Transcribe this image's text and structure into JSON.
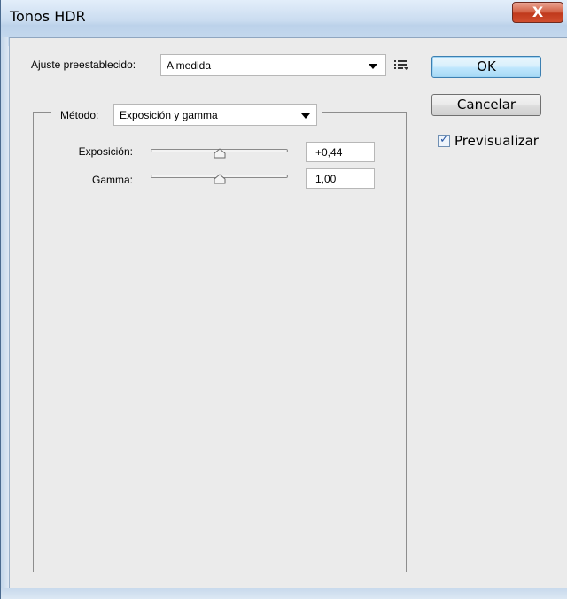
{
  "window": {
    "title": "Tonos HDR",
    "close_glyph": "X"
  },
  "preset": {
    "label": "Ajuste preestablecido:",
    "selected": "A medida",
    "menu_icon": "list-options-icon"
  },
  "buttons": {
    "ok": "OK",
    "cancel": "Cancelar"
  },
  "preview": {
    "label": "Previsualizar",
    "checked": true,
    "check_glyph": "✓"
  },
  "method": {
    "label": "Método:",
    "selected": "Exposición y gamma"
  },
  "sliders": [
    {
      "label": "Exposición:",
      "value": "+0,44",
      "level": 0.5
    },
    {
      "label": "Gamma:",
      "value": "1,00",
      "level": 0.5
    }
  ],
  "colors": {
    "ok_border": "#3c7fb1",
    "close_red": "#c0391c",
    "check_blue": "#2b5aa6"
  }
}
